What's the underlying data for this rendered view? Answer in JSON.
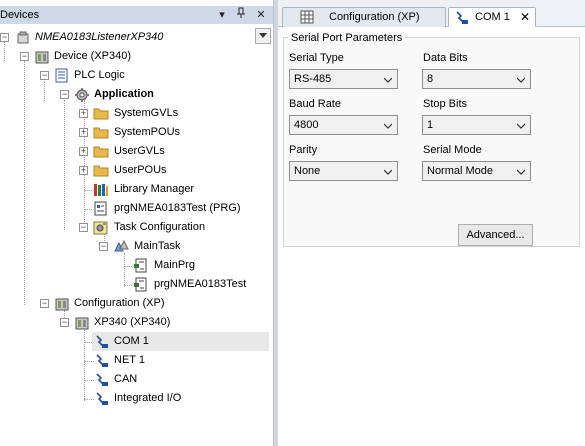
{
  "devices_panel": {
    "title": "Devices",
    "buttons": {
      "dropdown": "▾",
      "pin": "ᵡ",
      "close": "✕"
    },
    "tree": [
      {
        "label": "NMEA0183ListenerXP340",
        "icon": "project-icon",
        "style": "italic",
        "expanded": true
      },
      {
        "label": "Device (XP340)",
        "icon": "device-icon",
        "expanded": true
      },
      {
        "label": "PLC Logic",
        "icon": "plc-logic-icon",
        "expanded": true
      },
      {
        "label": "Application",
        "icon": "application-gear-icon",
        "style": "bold",
        "expanded": true
      },
      {
        "label": "SystemGVLs",
        "icon": "folder-icon",
        "expanded": false
      },
      {
        "label": "SystemPOUs",
        "icon": "folder-icon",
        "expanded": false
      },
      {
        "label": "UserGVLs",
        "icon": "folder-icon",
        "expanded": false
      },
      {
        "label": "UserPOUs",
        "icon": "folder-icon",
        "expanded": false
      },
      {
        "label": "Library Manager",
        "icon": "library-books-icon"
      },
      {
        "label": "prgNMEA0183Test (PRG)",
        "icon": "program-icon"
      },
      {
        "label": "Task Configuration",
        "icon": "task-config-icon",
        "expanded": true
      },
      {
        "label": "MainTask",
        "icon": "task-icon",
        "expanded": true
      },
      {
        "label": "MainPrg",
        "icon": "program-call-icon"
      },
      {
        "label": "prgNMEA0183Test",
        "icon": "program-call-icon"
      },
      {
        "label": "Configuration (XP)",
        "icon": "device-icon",
        "expanded": true
      },
      {
        "label": "XP340 (XP340)",
        "icon": "device-icon",
        "expanded": true
      },
      {
        "label": "COM 1",
        "icon": "serial-port-icon",
        "selected": true
      },
      {
        "label": "NET 1",
        "icon": "serial-port-icon"
      },
      {
        "label": "CAN",
        "icon": "serial-port-icon"
      },
      {
        "label": "Integrated I/O",
        "icon": "serial-port-icon"
      }
    ]
  },
  "editor": {
    "tabs": [
      {
        "label": "Configuration (XP)",
        "icon": "configuration-grid-icon",
        "active": false
      },
      {
        "label": "COM 1",
        "icon": "serial-port-icon",
        "active": true,
        "close": "✕"
      }
    ],
    "group_title": "Serial Port Parameters",
    "fields": {
      "serial_type": {
        "label": "Serial Type",
        "value": "RS-485"
      },
      "data_bits": {
        "label": "Data Bits",
        "value": "8"
      },
      "baud_rate": {
        "label": "Baud Rate",
        "value": "4800"
      },
      "stop_bits": {
        "label": "Stop Bits",
        "value": "1"
      },
      "parity": {
        "label": "Parity",
        "value": "None"
      },
      "serial_mode": {
        "label": "Serial Mode",
        "value": "Normal Mode"
      }
    },
    "advanced_button": "Advanced..."
  },
  "colors": {
    "header_bg": "#cfd8e6",
    "folder": "#e8b84a",
    "selection": "#e8e8e8",
    "splitter": "#cfd6e2"
  }
}
